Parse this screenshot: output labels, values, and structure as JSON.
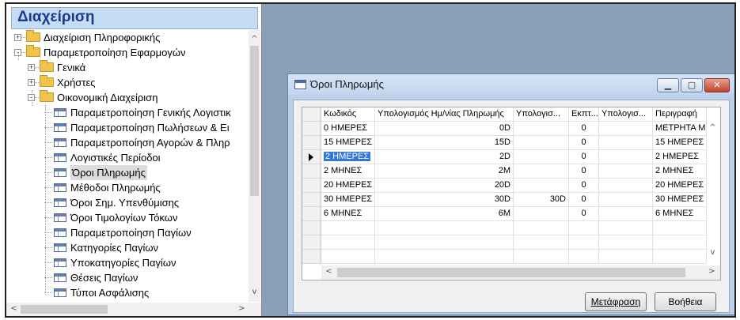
{
  "nav": {
    "title": "Διαχείριση",
    "items": [
      {
        "label": "Διαχείριση Πληροφορικής",
        "kind": "folder",
        "expander": "+"
      },
      {
        "label": "Παραμετροποίηση Εφαρμογών",
        "kind": "folder",
        "expander": "−"
      },
      {
        "label": "Γενικά",
        "kind": "folder",
        "expander": "+"
      },
      {
        "label": "Χρήστες",
        "kind": "folder",
        "expander": "+"
      },
      {
        "label": "Οικονομική Διαχείριση",
        "kind": "folder",
        "expander": "−"
      },
      {
        "label": "Παραμετροποίηση Γενικής Λογιστικ",
        "kind": "table"
      },
      {
        "label": "Παραμετροποίηση Πωλήσεων & Ει",
        "kind": "table"
      },
      {
        "label": "Παραμετροποίηση Αγορών & Πληρ",
        "kind": "table"
      },
      {
        "label": "Λογιστικές Περίοδοι",
        "kind": "table"
      },
      {
        "label": "Όροι Πληρωμής",
        "kind": "table",
        "selected": true
      },
      {
        "label": "Μέθοδοι Πληρωμής",
        "kind": "table"
      },
      {
        "label": "Όροι Σημ. Υπενθύμισης",
        "kind": "table"
      },
      {
        "label": "Όροι Τιμολογίων Τόκων",
        "kind": "table"
      },
      {
        "label": "Παραμετροποίηση Παγίων",
        "kind": "table"
      },
      {
        "label": "Κατηγορίες Παγίων",
        "kind": "table"
      },
      {
        "label": "Υποκατηγορίες Παγίων",
        "kind": "table"
      },
      {
        "label": "Θέσεις Παγίων",
        "kind": "table"
      },
      {
        "label": "Τύποι Ασφάλισης",
        "kind": "table"
      }
    ]
  },
  "dialog": {
    "title": "Όροι Πληρωμής",
    "columns": [
      "Κωδικός",
      "Υπολογισμός Ημ/νίας Πληρωμής",
      "Υπολογισ...",
      "Εκπτ...",
      "Υπολογισ...",
      "Περιγραφή"
    ],
    "rows": [
      [
        "0 ΗΜΕΡΕΣ",
        "0D",
        "",
        "0",
        "",
        "ΜΕΤΡΗΤΑ ΜΕ Π"
      ],
      [
        "15 ΗΜΕΡΕΣ",
        "15D",
        "",
        "0",
        "",
        "15 ΗΜΕΡΕΣ"
      ],
      [
        "2 ΗΜΕΡΕΣ",
        "2D",
        "",
        "0",
        "",
        "2 ΗΜΕΡΕΣ"
      ],
      [
        "2 ΜΗΝΕΣ",
        "2M",
        "",
        "0",
        "",
        "2 ΜΗΝΕΣ"
      ],
      [
        "20 ΗΜΕΡΕΣ",
        "20D",
        "",
        "0",
        "",
        "20 ΗΜΕΡΕΣ"
      ],
      [
        "30 ΗΜΕΡΕΣ",
        "30D",
        "30D",
        "0",
        "",
        "30 ΗΜΕΡΕΣ"
      ],
      [
        "6 ΜΗΝΕΣ",
        "6M",
        "",
        "0",
        "",
        "6 ΜΗΝΕΣ"
      ]
    ],
    "empty_rows": 3,
    "current_row": 2,
    "buttons": {
      "translate": "Μετάφραση",
      "help": "Βοήθεια"
    }
  }
}
